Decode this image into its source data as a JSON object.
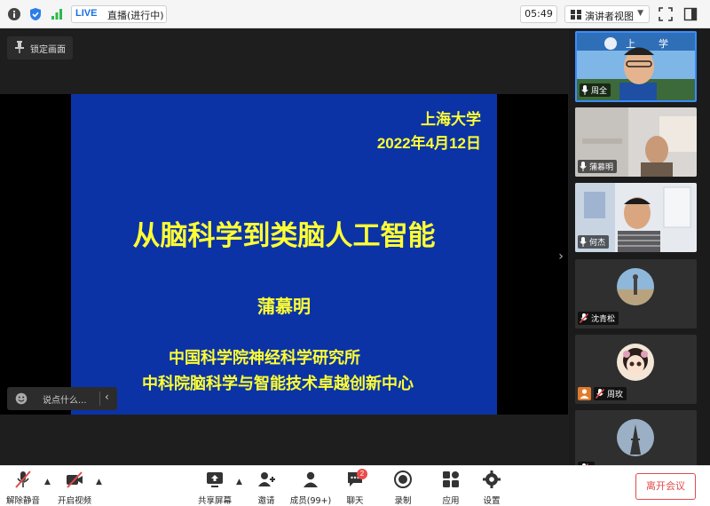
{
  "topbar": {
    "live_tag": "LIVE",
    "live_status": "直播(进行中)",
    "time": "05:49",
    "view_mode": "演讲者视图"
  },
  "stage": {
    "lock_label": "锁定画面",
    "chat_placeholder": "说点什么...",
    "slide": {
      "university": "上海大学",
      "date": "2022年4月12日",
      "title": "从脑科学到类脑人工智能",
      "speaker": "蒲慕明",
      "institution_1": "中国科学院神经科学研究所",
      "institution_2": "中科院脑科学与智能技术卓越创新中心",
      "text_color": "#ffff33",
      "background_color": "#0b33a6"
    }
  },
  "participants": [
    {
      "name": "周全",
      "video": true,
      "mic": "on",
      "active_speaker": true
    },
    {
      "name": "蒲慕明",
      "video": true,
      "mic": "on"
    },
    {
      "name": "何杰",
      "video": true,
      "mic": "on"
    },
    {
      "name": "沈青松",
      "video": false,
      "mic": "muted"
    },
    {
      "name": "周玫",
      "video": false,
      "mic": "muted",
      "host": true
    },
    {
      "name": "",
      "video": false,
      "mic": "muted"
    }
  ],
  "toolbar": {
    "unmute": "解除静音",
    "start_video": "开启视频",
    "share_screen": "共享屏幕",
    "invite": "邀请",
    "members": "成员(99+)",
    "chat": "聊天",
    "chat_badge": "2",
    "record": "录制",
    "apps": "应用",
    "settings": "设置",
    "leave": "离开会议"
  },
  "colors": {
    "accent": "#3b8cff",
    "danger": "#e24b4b",
    "slide_bg": "#0b33a6",
    "slide_text": "#ffff33"
  }
}
